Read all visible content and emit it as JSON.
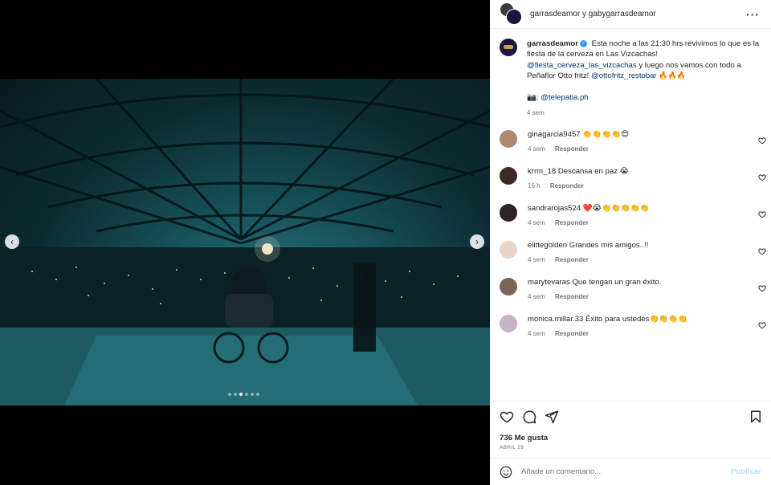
{
  "header": {
    "users": "garrasdeamor y gabygarrasdeamor",
    "more_icon": "more-horizontal-icon"
  },
  "caption": {
    "username": "garrasdeamor",
    "text_1": "Esta noche a las 21:30 hrs revivimos lo que es la fiesta de la cerveza en Las Vizcachas!",
    "mention_1": "@fiesta_cerveza_las_vizcachas",
    "text_2": " y luego nos vamos con todo a Peñaflor Otto fritz! ",
    "mention_2": "@ottofritz_restobar",
    "emojis": "🔥🔥🔥",
    "camera": "📷: ",
    "photo_credit": "@telepatia.ph",
    "time": "4 sem"
  },
  "comments": [
    {
      "user": "ginagarcia9457",
      "text": "👏👏👏👏😍",
      "time": "4 sem",
      "reply": "Responder",
      "avatar_color": "#b08a70"
    },
    {
      "user": "krrm_18",
      "text": "Descansa en paz 😭",
      "time": "16 h",
      "reply": "Responder",
      "avatar_color": "#3a2b26"
    },
    {
      "user": "sandrarojas524",
      "text": "❤️😭👏👏👏👏👏",
      "time": "4 sem",
      "reply": "Responder",
      "avatar_color": "#2c2424"
    },
    {
      "user": "elittegolden",
      "text": "Grandes mis amigos..!!",
      "time": "4 sem",
      "reply": "Responder",
      "avatar_color": "#e8d6c8"
    },
    {
      "user": "marytevaras",
      "text": "Que tengan un gran éxito.",
      "time": "4 sem",
      "reply": "Responder",
      "avatar_color": "#7b6558"
    },
    {
      "user": "monica.millar.33",
      "text": "Éxito para ustedes👏👏👏👏",
      "time": "4 sem",
      "reply": "Responder",
      "avatar_color": "#c7b2c9"
    }
  ],
  "actions": {
    "likes": "736 Me gusta",
    "date": "ABRIL 29"
  },
  "add_comment": {
    "placeholder": "Añade un comentario...",
    "publish": "Publicar"
  },
  "carousel": {
    "total": 6,
    "active_index": 2
  }
}
